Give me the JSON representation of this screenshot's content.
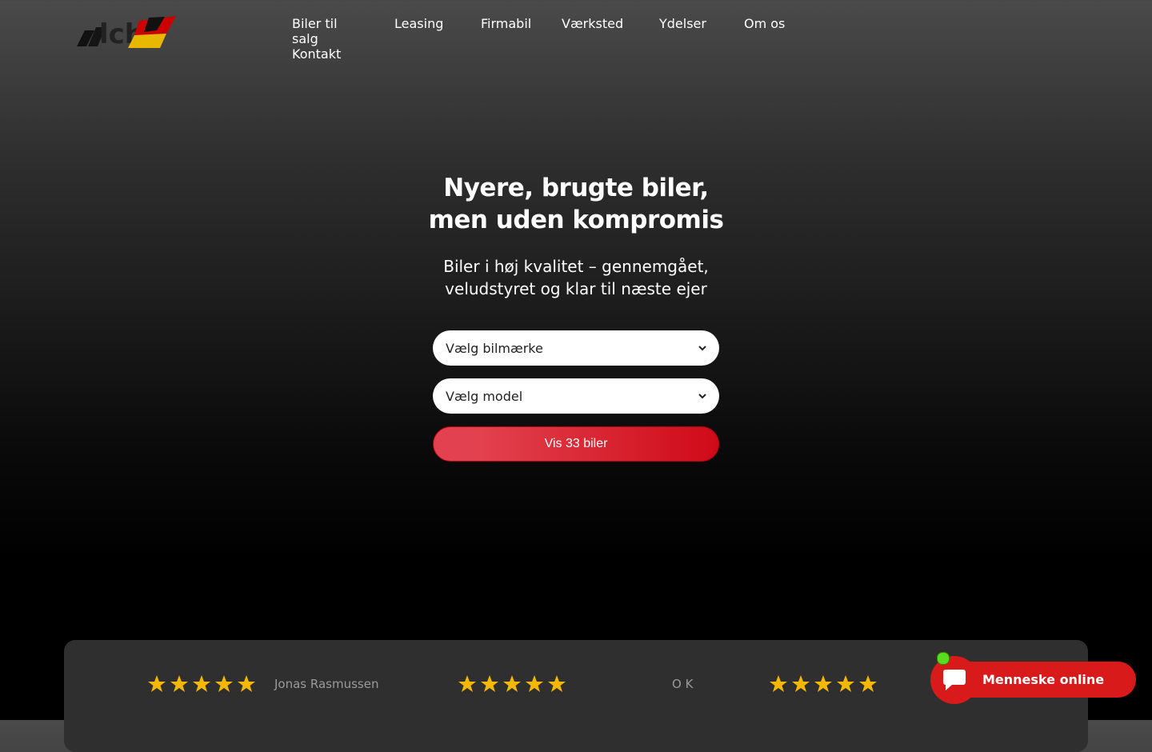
{
  "brand": {
    "logo_text": "lch"
  },
  "nav": {
    "items": [
      "Biler til salg",
      "Leasing",
      "Firmabil",
      "Værksted",
      "Ydelser",
      "Om os",
      "Kontakt"
    ]
  },
  "hero": {
    "title_line1": "Nyere, brugte biler,",
    "title_line2": "men uden kompromis",
    "subtitle_line1": "Biler i høj kvalitet – gennemgået,",
    "subtitle_line2": "veludstyret og klar til næste ejer"
  },
  "search": {
    "brand_select": "Vælg bilmærke",
    "model_select": "Vælg model",
    "submit_label": "Vis 33 biler"
  },
  "reviews": [
    {
      "rating": 5,
      "name": "Jonas Rasmussen"
    },
    {
      "rating": 5,
      "name": "O K"
    },
    {
      "rating": 5,
      "name": ""
    }
  ],
  "chat": {
    "label": "Menneske online",
    "status_color": "#5bdc1e"
  },
  "colors": {
    "accent": "#d91a1a",
    "star": "#f5b800"
  }
}
